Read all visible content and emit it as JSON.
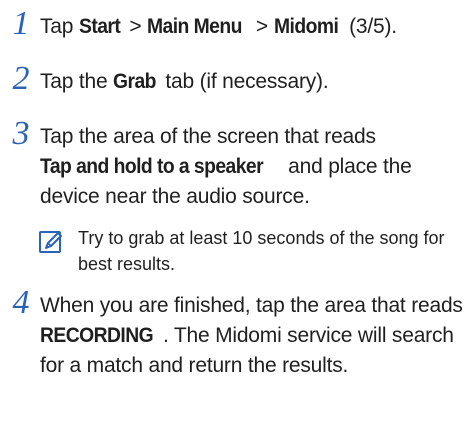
{
  "steps": [
    {
      "number": "1",
      "parts": [
        {
          "text": "Tap ",
          "bold": false
        },
        {
          "text": "Start",
          "bold": true
        },
        {
          "text": " > ",
          "bold": false
        },
        {
          "text": "Main Menu",
          "bold": true
        },
        {
          "text": " > ",
          "bold": false
        },
        {
          "text": "Midomi",
          "bold": true
        },
        {
          "text": " (3/5).",
          "bold": false
        }
      ]
    },
    {
      "number": "2",
      "parts": [
        {
          "text": "Tap the ",
          "bold": false
        },
        {
          "text": "Grab",
          "bold": true
        },
        {
          "text": " tab (if necessary).",
          "bold": false
        }
      ]
    },
    {
      "number": "3",
      "parts": [
        {
          "text": "Tap the area of the screen that reads ",
          "bold": false
        },
        {
          "text": "Tap and hold to a speaker",
          "bold": true
        },
        {
          "text": " and place the device near the audio source.",
          "bold": false
        }
      ]
    },
    {
      "number": "4",
      "parts": [
        {
          "text": "When you are finished, tap the area that reads ",
          "bold": false
        },
        {
          "text": "RECORDING",
          "bold": true
        },
        {
          "text": ". The Midomi service will search for a match and return the results.",
          "bold": false
        }
      ]
    }
  ],
  "note": {
    "icon": "note-pencil-icon",
    "text": "Try to grab at least 10 seconds of the song for best results."
  },
  "colors": {
    "accent": "#2a63b8",
    "text": "#1f1f1f"
  }
}
